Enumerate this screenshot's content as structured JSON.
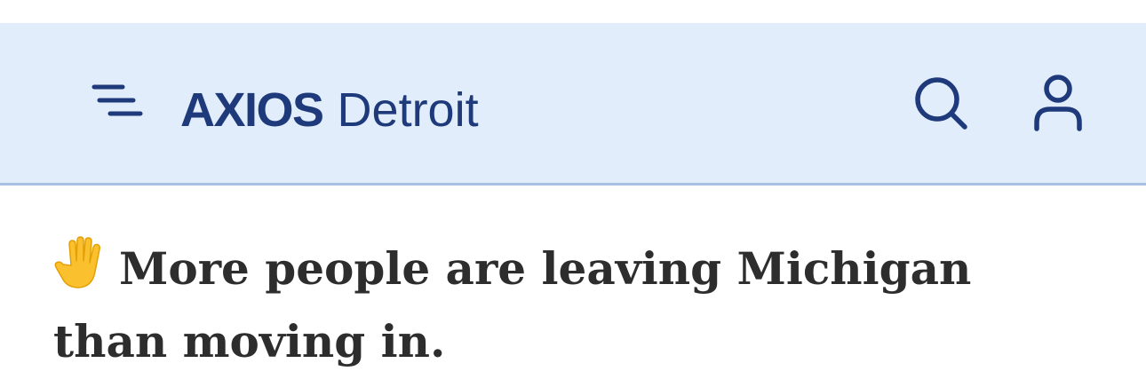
{
  "header": {
    "brand": "AXIOS",
    "city": "Detroit",
    "menu_icon": "menu-icon",
    "search_icon": "search-icon",
    "account_icon": "user-icon",
    "background_color": "#e2edfb",
    "brand_color": "#1e3a7b"
  },
  "article": {
    "emoji_icon": "raised-hand-icon",
    "headline": "More people are leaving Michigan than moving in."
  }
}
